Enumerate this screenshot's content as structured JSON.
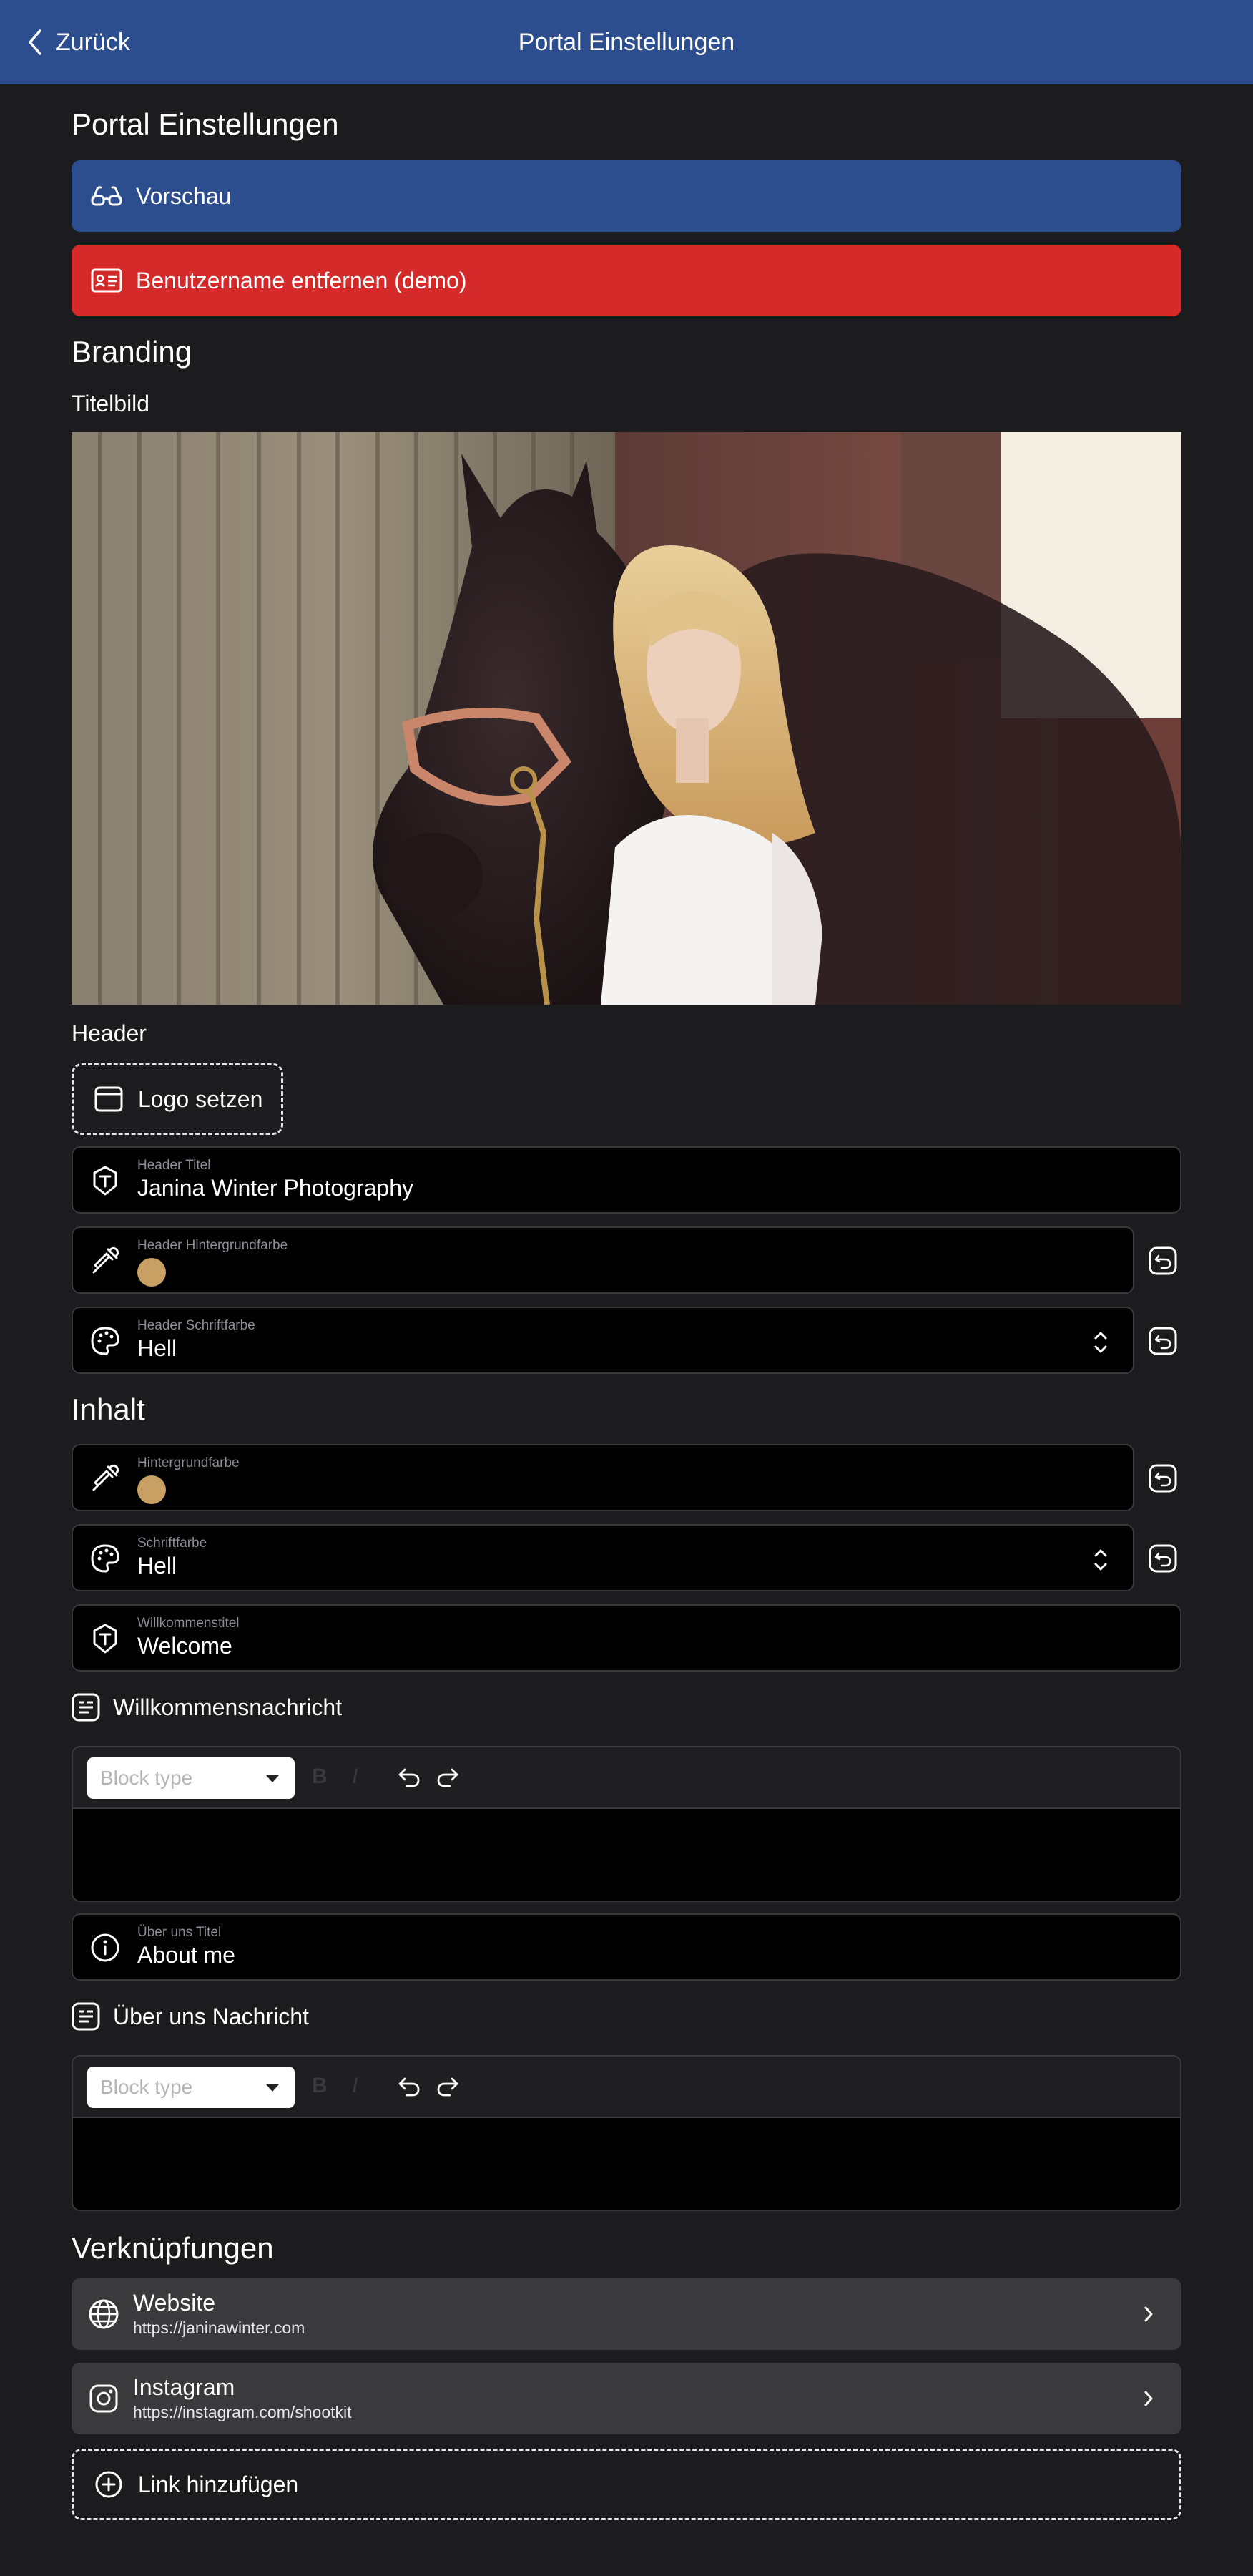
{
  "nav": {
    "back_label": "Zurück",
    "title": "Portal Einstellungen"
  },
  "page": {
    "heading": "Portal Einstellungen"
  },
  "actions": {
    "preview_label": "Vorschau",
    "remove_username_label": "Benutzername entfernen (demo)"
  },
  "branding": {
    "heading": "Branding",
    "title_image_label": "Titelbild",
    "header_label": "Header",
    "logo_button_label": "Logo setzen",
    "header_title": {
      "label": "Header Titel",
      "value": "Janina Winter Photography"
    },
    "header_bg_color": {
      "label": "Header Hintergrundfarbe",
      "color": "#c9a063"
    },
    "header_font_color": {
      "label": "Header Schriftfarbe",
      "value": "Hell"
    }
  },
  "content": {
    "heading": "Inhalt",
    "bg_color": {
      "label": "Hintergrundfarbe",
      "color": "#c9a063"
    },
    "font_color": {
      "label": "Schriftfarbe",
      "value": "Hell"
    },
    "welcome_title": {
      "label": "Willkommenstitel",
      "value": "Welcome"
    },
    "welcome_message_label": "Willkommensnachricht",
    "about_title": {
      "label": "Über uns Titel",
      "value": "About me"
    },
    "about_message_label": "Über uns Nachricht",
    "editor": {
      "block_type_placeholder": "Block type",
      "bold": "B",
      "italic": "I"
    }
  },
  "links": {
    "heading": "Verknüpfungen",
    "items": [
      {
        "title": "Website",
        "url": "https://janinawinter.com",
        "icon": "globe-icon"
      },
      {
        "title": "Instagram",
        "url": "https://instagram.com/shootkit",
        "icon": "instagram-icon"
      }
    ],
    "add_label": "Link hinzufügen"
  },
  "colors": {
    "nav_bar": "#2c4d8e",
    "danger": "#d42a2a",
    "background": "#1c1c1e",
    "swatch": "#c9a063"
  }
}
